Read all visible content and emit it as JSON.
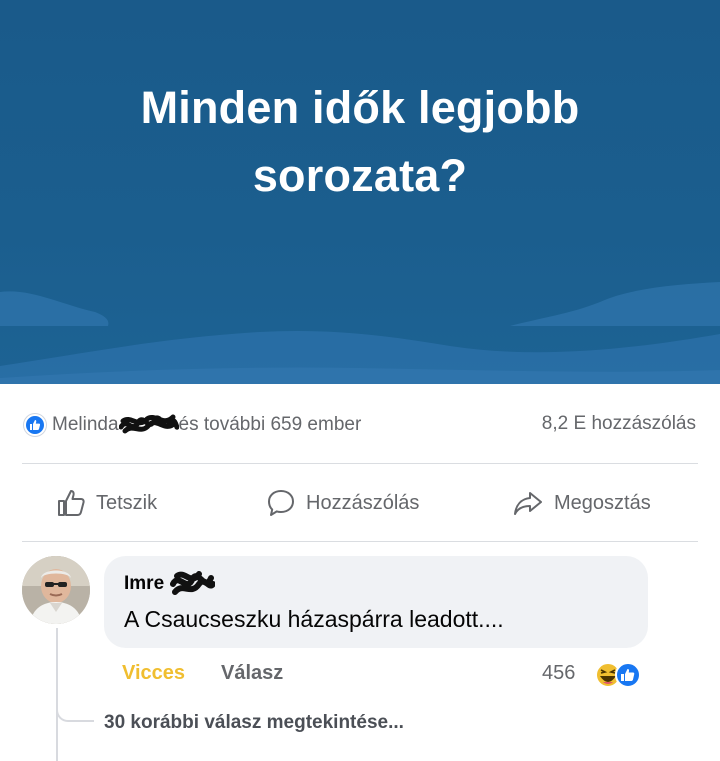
{
  "post": {
    "banner_title_line1": "Minden idők legjobb",
    "banner_title_line2": "sorozata?",
    "banner_color": "#1b5e8e"
  },
  "stats": {
    "reactor_name": "Melinda",
    "reactor_rest": "és további 659 ember",
    "comment_count": "8,2 E hozzászólás",
    "like_color": "#1877f2"
  },
  "actions": {
    "like_label": "Tetszik",
    "comment_label": "Hozzászólás",
    "share_label": "Megosztás"
  },
  "comment": {
    "author": "Imre",
    "text": "A Csaucseszku házaspárra leadott....",
    "reaction_label": "Vicces",
    "reply_label": "Válasz",
    "reaction_count": "456",
    "haha_color": "#f0be30"
  },
  "replies": {
    "more_label": "30 korábbi válasz megtekintése..."
  }
}
